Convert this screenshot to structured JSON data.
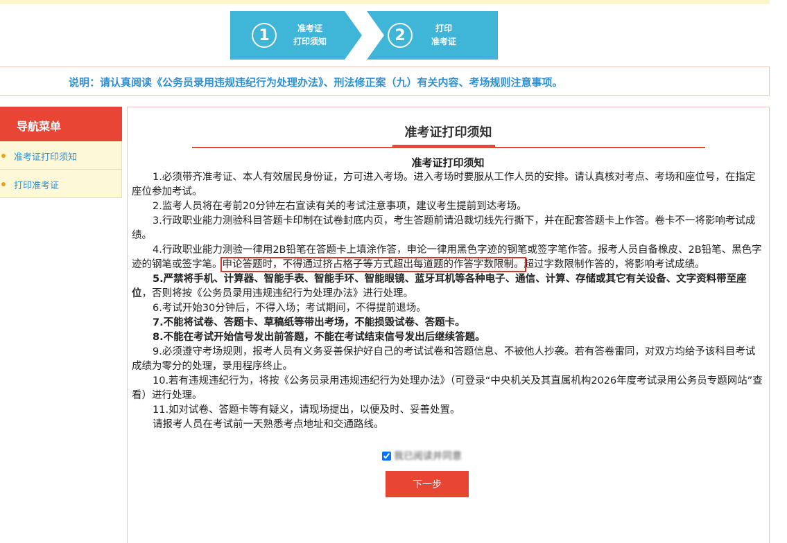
{
  "steps": [
    {
      "number": "1",
      "line1": "准考证",
      "line2": "打印须知"
    },
    {
      "number": "2",
      "line1": "打印",
      "line2": "准考证"
    }
  ],
  "notice": "说明：请认真阅读《公务员录用违规违纪行为处理办法》、刑法修正案（九）有关内容、考场规则注意事项。",
  "sidebar": {
    "title": "导航菜单",
    "items": [
      {
        "label": "准考证打印须知"
      },
      {
        "label": "打印准考证"
      }
    ]
  },
  "panel": {
    "title": "准考证打印须知",
    "content_title": "准考证打印须知",
    "items": {
      "p1": "1.必须带齐准考证、本人有效居民身份证，方可进入考场。进入考场时要服从工作人员的安排。请认真核对考点、考场和座位号，在指定座位参加考试。",
      "p2": "2.监考人员将在考前20分钟左右宣读有关的考试注意事项，建议考生提前到达考场。",
      "p3": "3.行政职业能力测验科目答题卡印制在试卷封底内页，考生答题前请沿裁切线先行撕下，并在配套答题卡上作答。卷卡不一将影响考试成绩。",
      "p4a": "4.行政职业能力测验一律用2B铅笔在答题卡上填涂作答，申论一律用黑色字迹的钢笔或签字笔作答。报考人员自备橡皮、2B铅笔、黑色字迹的钢笔或签字笔。",
      "p4b": "申论答题时，不得通过挤占格子等方式超出每道题的作答字数限制。",
      "p4c": "超过字数限制作答的，将影响考试成绩。",
      "p5a": "5.严禁将手机、计算器、智能手表、智能手环、智能眼镜、蓝牙耳机等各种电子、通信、计算、存储或其它有关设备、文字资料带至座位",
      "p5b": "，否则将按《公务员录用违规违纪行为处理办法》进行处理。",
      "p6": "6.考试开始30分钟后，不得入场；考试期间，不得提前退场。",
      "p7": "7.不能将试卷、答题卡、草稿纸等带出考场，不能损毁试卷、答题卡。",
      "p8": "8.不能在考试开始信号发出前答题，不能在考试结束信号发出后继续答题。",
      "p9": "9.必须遵守考场规则，报考人员有义务妥善保护好自己的考试试卷和答题信息、不被他人抄袭。若有答卷雷同，对双方均给予该科目考试成绩为零分的处理，录用程序终止。",
      "p10": "10.若有违规违纪行为，将按《公务员录用违规违纪行为处理办法》（可登录“中央机关及其直属机构2026年度考试录用公务员专题网站”查看）进行处理。",
      "p11": "11.如对试卷、答题卡等有疑义，请现场提出，以便及时、妥善处置。",
      "p12": "请报考人员在考试前一天熟悉考点地址和交通路线。"
    },
    "agree_label": "我已阅读并同意",
    "next_button": "下一步"
  }
}
